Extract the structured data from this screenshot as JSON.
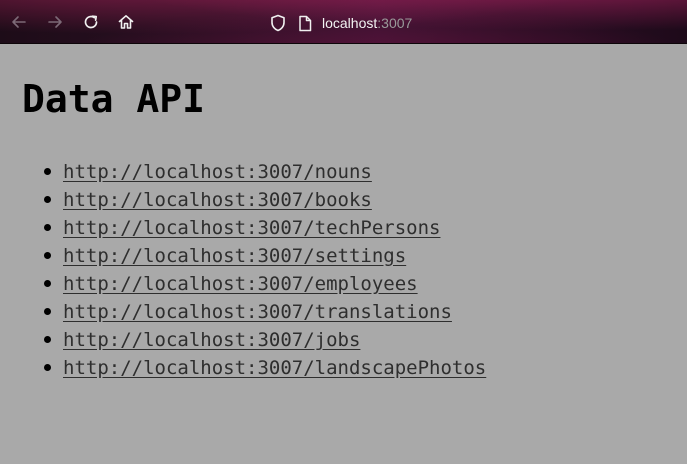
{
  "browser": {
    "url_host": "localhost",
    "url_port": ":3007"
  },
  "page": {
    "title": "Data API",
    "links": [
      "http://localhost:3007/nouns",
      "http://localhost:3007/books",
      "http://localhost:3007/techPersons",
      "http://localhost:3007/settings",
      "http://localhost:3007/employees",
      "http://localhost:3007/translations",
      "http://localhost:3007/jobs",
      "http://localhost:3007/landscapePhotos"
    ]
  },
  "icons": {
    "back": "arrow-left-icon",
    "forward": "arrow-right-icon",
    "reload": "reload-icon",
    "home": "home-icon",
    "shield": "shield-icon",
    "page": "page-icon"
  }
}
